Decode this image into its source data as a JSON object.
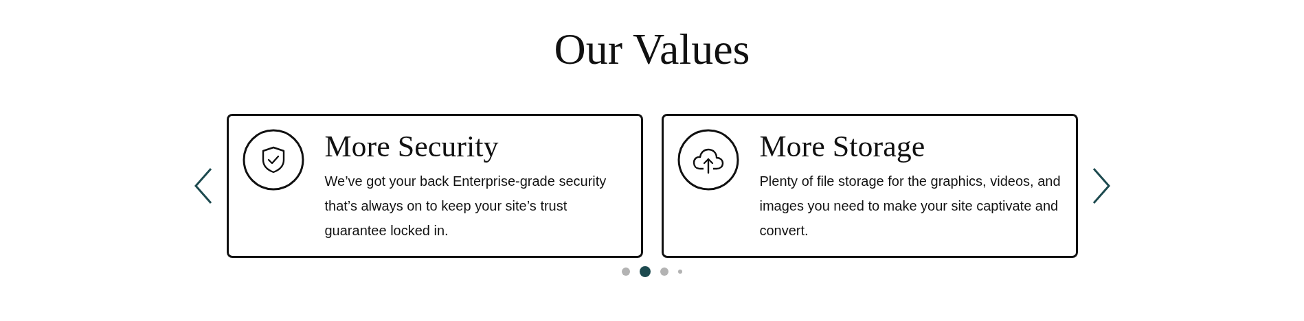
{
  "title": "Our Values",
  "cards": [
    {
      "kind": "shield",
      "heading": "More Security",
      "text": "We’ve got your back Enterprise-grade security that’s always on to keep your site’s trust guarantee locked in."
    },
    {
      "kind": "cloud",
      "heading": "More Storage",
      "text": "Plenty of file storage for the graphics, videos, and images you need to make your site captivate and convert."
    }
  ],
  "dots": [
    {
      "selected": false,
      "kind": "full"
    },
    {
      "selected": true,
      "kind": "full"
    },
    {
      "selected": false,
      "kind": "full"
    },
    {
      "selected": false,
      "kind": "small"
    }
  ]
}
